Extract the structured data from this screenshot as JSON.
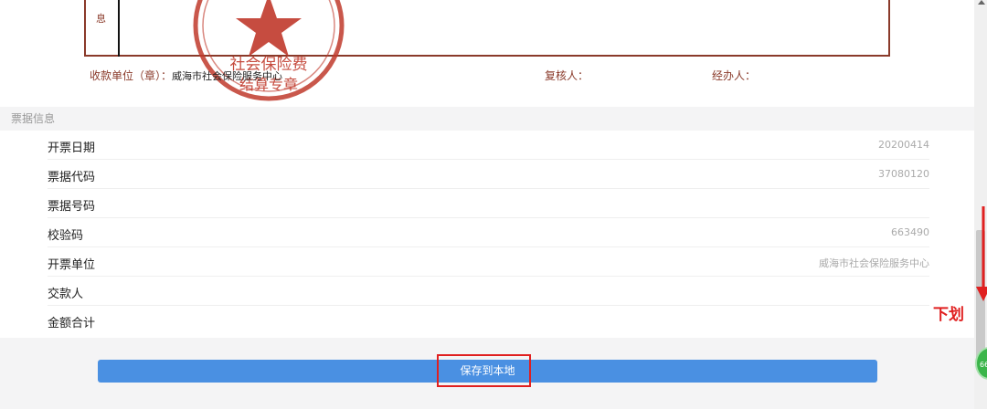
{
  "receipt": {
    "row_label": "息",
    "payee_label": "收款单位（章）：",
    "payee_value": "威海市社会保险服务中心",
    "reviewer_label": "复核人：",
    "handler_label": "经办人：",
    "seal_text_top": "社会保险费",
    "seal_text_bottom": "结算专章"
  },
  "section": {
    "title": "票据信息"
  },
  "info_rows": [
    {
      "label": "开票日期",
      "value": "20200414"
    },
    {
      "label": "票据代码",
      "value": "37080120"
    },
    {
      "label": "票据号码",
      "value": ""
    },
    {
      "label": "校验码",
      "value": "663490"
    },
    {
      "label": "开票单位",
      "value": "威海市社会保险服务中心"
    },
    {
      "label": "交款人",
      "value": ""
    },
    {
      "label": "金额合计",
      "value": ""
    }
  ],
  "save_button": {
    "label": "保存到本地"
  },
  "annotation": {
    "text": "下划",
    "color": "#e02020"
  },
  "float_badge": {
    "text": "66"
  },
  "colors": {
    "accent": "#4a90e2",
    "highlight": "#e02020",
    "seal": "#c0392b"
  }
}
